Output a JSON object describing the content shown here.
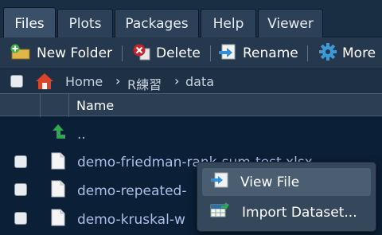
{
  "tabs": [
    {
      "label": "Files",
      "active": true
    },
    {
      "label": "Plots",
      "active": false
    },
    {
      "label": "Packages",
      "active": false
    },
    {
      "label": "Help",
      "active": false
    },
    {
      "label": "Viewer",
      "active": false
    }
  ],
  "toolbar": {
    "new_folder": "New Folder",
    "delete": "Delete",
    "rename": "Rename",
    "more": "More"
  },
  "breadcrumb": {
    "home": "Home",
    "folder": "R練習",
    "current": "data"
  },
  "table": {
    "header_name": "Name",
    "parent_label": "..",
    "files": [
      "demo-friedman-rank-sum-test.xlsx",
      "demo-repeated-",
      "demo-kruskal-w"
    ]
  },
  "context_menu": {
    "items": [
      {
        "label": "View File",
        "icon": "view-file-icon"
      },
      {
        "label": "Import Dataset...",
        "icon": "import-dataset-icon"
      }
    ]
  },
  "colors": {
    "background": "#0b1f36",
    "file_link": "#b0bde8",
    "up_arrow": "#2fa84f",
    "home_icon": "#d9442b"
  }
}
